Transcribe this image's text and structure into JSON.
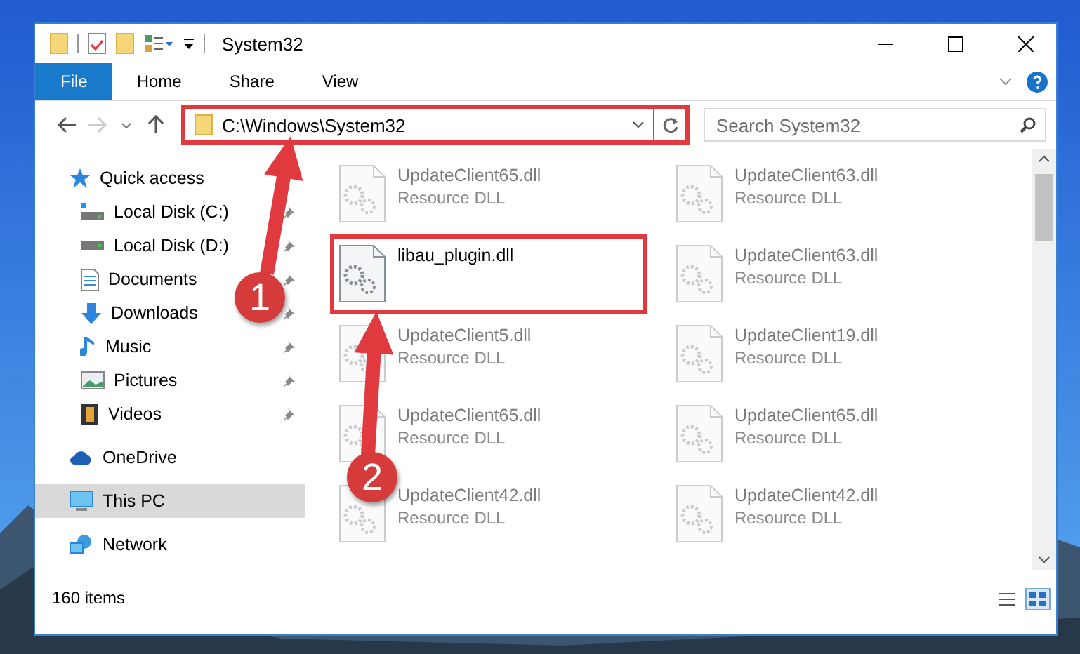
{
  "window": {
    "title": "System32"
  },
  "ribbon_tabs": [
    {
      "label": "File",
      "selected": true
    },
    {
      "label": "Home",
      "selected": false
    },
    {
      "label": "Share",
      "selected": false
    },
    {
      "label": "View",
      "selected": false
    }
  ],
  "address": {
    "path": "C:\\Windows\\System32",
    "highlighted": true
  },
  "search": {
    "placeholder": "Search System32"
  },
  "sidebar": {
    "items": [
      {
        "label": "Quick access",
        "selected": false,
        "children": [
          {
            "label": "Local Disk (C:)",
            "pinned": true
          },
          {
            "label": "Local Disk (D:)",
            "pinned": true
          },
          {
            "label": "Documents",
            "pinned": true
          },
          {
            "label": "Downloads",
            "pinned": true
          },
          {
            "label": "Music",
            "pinned": true
          },
          {
            "label": "Pictures",
            "pinned": true
          },
          {
            "label": "Videos",
            "pinned": true
          }
        ]
      },
      {
        "label": "OneDrive",
        "selected": false
      },
      {
        "label": "This PC",
        "selected": true
      },
      {
        "label": "Network",
        "selected": false
      }
    ]
  },
  "files": [
    {
      "name": "UpdateClient65.dll",
      "type": "Resource DLL",
      "blurred": true,
      "highlighted": false
    },
    {
      "name": "UpdateClient63.dll",
      "type": "Resource DLL",
      "blurred": true,
      "highlighted": false
    },
    {
      "name": "libau_plugin.dll",
      "blurred": false,
      "highlighted": true
    },
    {
      "name": "UpdateClient63.dll",
      "type": "Resource DLL",
      "blurred": true,
      "highlighted": false
    },
    {
      "name": "UpdateClient5.dll",
      "type": "Resource DLL",
      "blurred": true,
      "highlighted": false
    },
    {
      "name": "UpdateClient19.dll",
      "type": "Resource DLL",
      "blurred": true,
      "highlighted": false
    },
    {
      "name": "UpdateClient65.dll",
      "type": "Resource DLL",
      "blurred": true,
      "highlighted": false
    },
    {
      "name": "UpdateClient65.dll",
      "type": "Resource DLL",
      "blurred": true,
      "highlighted": false
    },
    {
      "name": "UpdateClient42.dll",
      "type": "Resource DLL",
      "blurred": true,
      "highlighted": false
    },
    {
      "name": "UpdateClient42.dll",
      "type": "Resource DLL",
      "blurred": true,
      "highlighted": false
    }
  ],
  "annotations": [
    {
      "number": "1"
    },
    {
      "number": "2"
    }
  ],
  "status_bar": {
    "text": "160 items"
  },
  "view_buttons": [
    {
      "selected": false
    },
    {
      "selected": true
    }
  ]
}
